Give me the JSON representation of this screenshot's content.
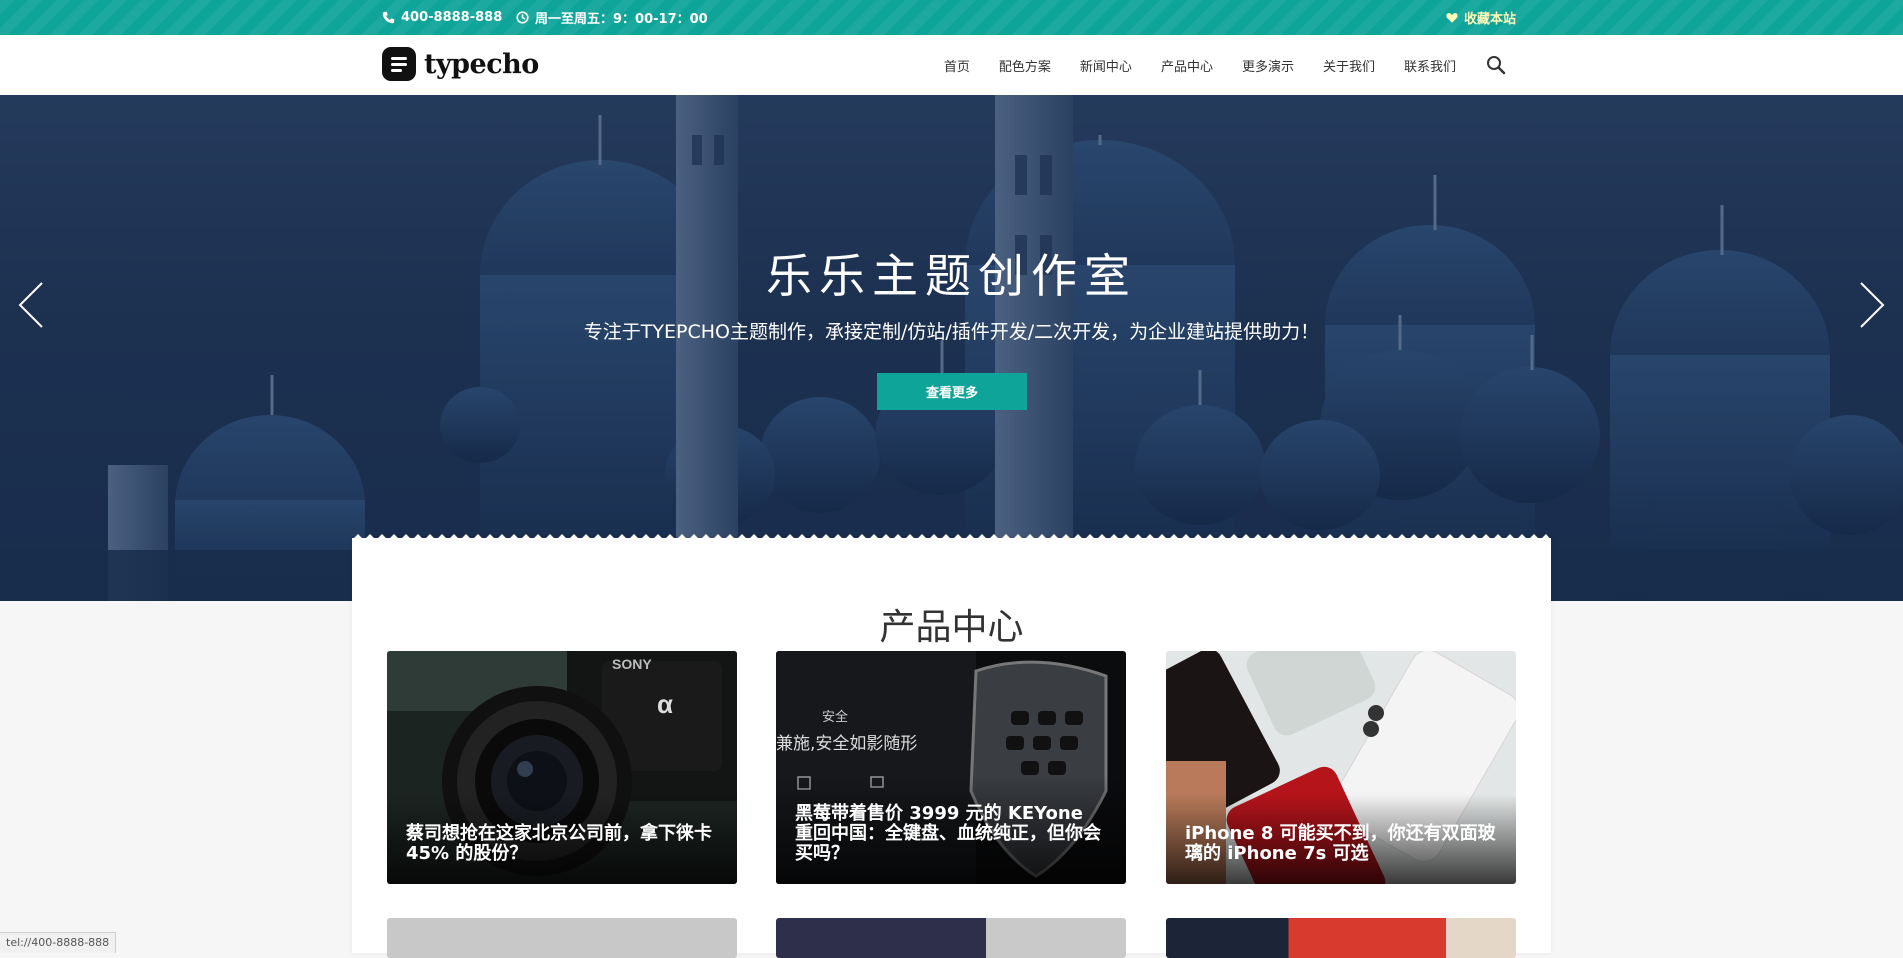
{
  "topbar": {
    "phone": "400-8888-888",
    "hours": "周一至周五：9：00-17：00",
    "favorite": "收藏本站"
  },
  "header": {
    "logo_text": "typecho",
    "nav": [
      "首页",
      "配色方案",
      "新闻中心",
      "产品中心",
      "更多演示",
      "关于我们",
      "联系我们"
    ]
  },
  "hero": {
    "title": "乐乐主题创作室",
    "subtitle": "专注于TYEPCHO主题制作，承接定制/仿站/插件开发/二次开发，为企业建站提供助力！",
    "button": "查看更多"
  },
  "products": {
    "title": "产品中心",
    "items": [
      {
        "caption": "蔡司想抢在这家北京公司前，拿下徕卡 45% 的股份？"
      },
      {
        "caption": "黑莓带着售价 3999 元的 KEYone 重回中国：全键盘、血统纯正，但你会买吗？",
        "image_text_1": "安全",
        "image_text_2": "兼施,安全如影随形"
      },
      {
        "caption": "iPhone 8 可能买不到，你还有双面玻璃的 iPhone 7s 可选"
      }
    ]
  },
  "status_bar": "tel://400-8888-888",
  "colors": {
    "accent": "#0ea49a",
    "hero": "#243b5d"
  }
}
